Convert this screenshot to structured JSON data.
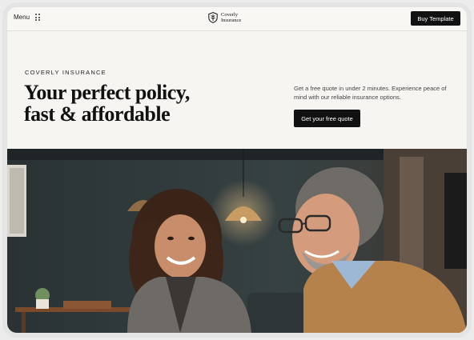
{
  "nav": {
    "menu_label": "Menu",
    "logo_line1": "Coverly",
    "logo_line2": "Insurance",
    "buy_label": "Buy Template"
  },
  "hero": {
    "eyebrow": "COVERLY INSURANCE",
    "headline_line1": "Your perfect policy,",
    "headline_line2": "fast & affordable",
    "subtext": "Get a free quote in under 2 minutes. Experience peace of mind with our reliable insurance options.",
    "cta_label": "Get your free quote"
  },
  "icons": {
    "menu": "grid-dots-icon",
    "logo": "shield-leaf-icon"
  },
  "colors": {
    "background": "#f6f5f2",
    "button": "#111111",
    "text": "#111111"
  }
}
